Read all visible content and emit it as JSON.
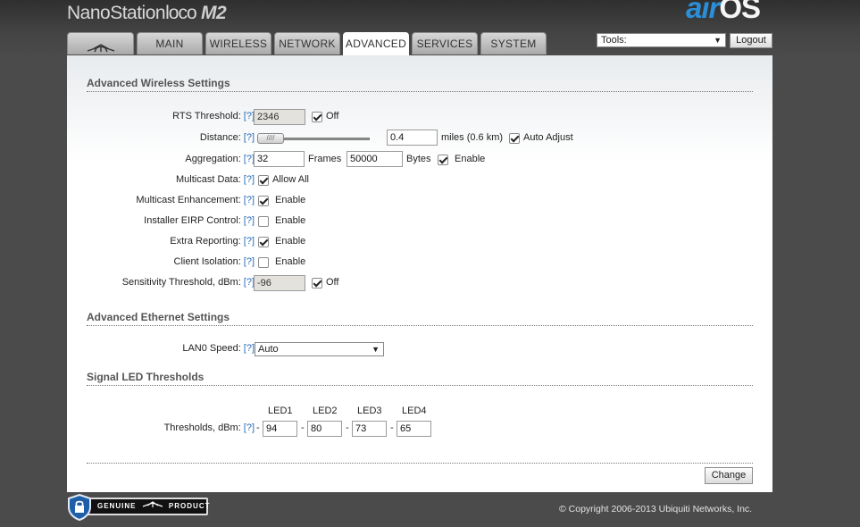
{
  "header": {
    "product_name": "NanoStation",
    "product_variant": "loco",
    "product_model": "M2",
    "brand_air": "air",
    "brand_os": "OS"
  },
  "tabs": [
    {
      "label": "",
      "icon": "ubiquiti-logo-icon"
    },
    {
      "label": "MAIN"
    },
    {
      "label": "WIRELESS"
    },
    {
      "label": "NETWORK"
    },
    {
      "label": "ADVANCED",
      "active": true
    },
    {
      "label": "SERVICES"
    },
    {
      "label": "SYSTEM"
    }
  ],
  "tools": {
    "selected": "Tools:"
  },
  "logout_label": "Logout",
  "help_link": "[?]",
  "sections": {
    "wireless": "Advanced Wireless Settings",
    "ethernet": "Advanced Ethernet Settings",
    "led": "Signal LED Thresholds"
  },
  "wireless": {
    "rts": {
      "label": "RTS Threshold:",
      "value": "2346",
      "off_label": "Off",
      "off_checked": true
    },
    "distance": {
      "label": "Distance:",
      "slider_fraction": 0.0,
      "value": "0.4",
      "unit_text": "miles (0.6 km)",
      "auto_label": "Auto Adjust",
      "auto_checked": true
    },
    "aggregation": {
      "label": "Aggregation:",
      "frames": "32",
      "frames_label": "Frames",
      "bytes": "50000",
      "bytes_label": "Bytes",
      "enable_label": "Enable",
      "enable_checked": true
    },
    "multicast": {
      "label": "Multicast Data:",
      "text": "Allow All",
      "checked": true
    },
    "multicast_enh": {
      "label": "Multicast Enhancement:",
      "text": "Enable",
      "checked": true
    },
    "eirp": {
      "label": "Installer EIRP Control:",
      "text": "Enable",
      "checked": false
    },
    "extra": {
      "label": "Extra Reporting:",
      "text": "Enable",
      "checked": true
    },
    "isolation": {
      "label": "Client Isolation:",
      "text": "Enable",
      "checked": false
    },
    "sensitivity": {
      "label": "Sensitivity Threshold, dBm:",
      "value": "-96",
      "off_label": "Off",
      "off_checked": true
    }
  },
  "ethernet": {
    "lan0": {
      "label": "LAN0 Speed:",
      "value": "Auto"
    }
  },
  "led": {
    "label": "Thresholds, dBm:",
    "headers": [
      "LED1",
      "LED2",
      "LED3",
      "LED4"
    ],
    "values": [
      "94",
      "80",
      "73",
      "65"
    ],
    "sep": "-"
  },
  "change_label": "Change",
  "footer": {
    "badge_left": "GENUINE",
    "badge_right": "PRODUCT",
    "copyright": "© Copyright 2006-2013 Ubiquiti Networks, Inc."
  }
}
